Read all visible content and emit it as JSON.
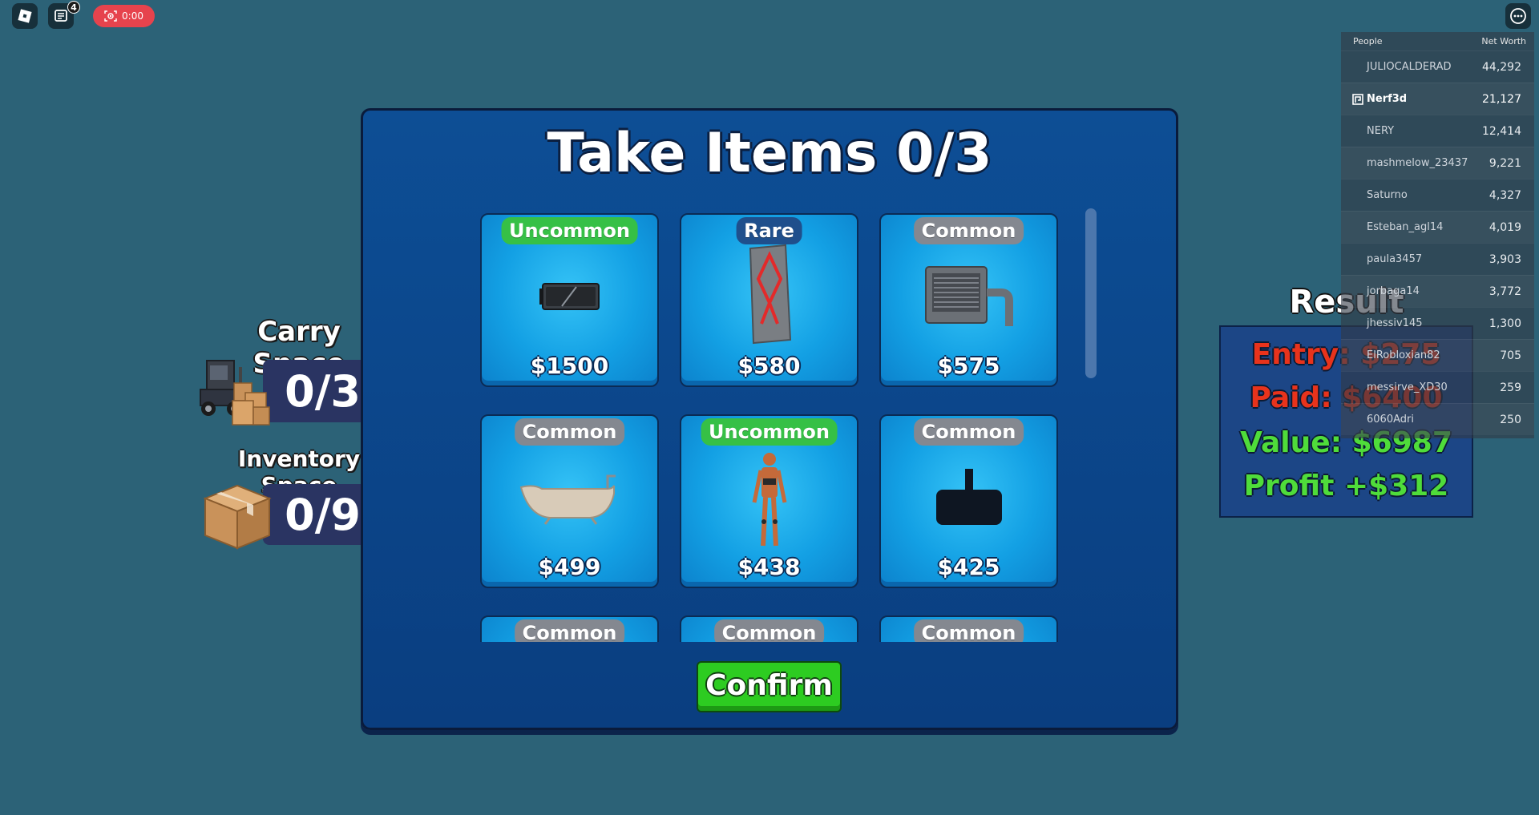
{
  "topbar": {
    "chat_badge": "4",
    "record_time": "0:00"
  },
  "carry": {
    "title": "Carry Space",
    "value": "0/3"
  },
  "inventory": {
    "title": "Inventory Space",
    "value": "0/9"
  },
  "panel": {
    "title": "Take Items 0/3",
    "confirm_label": "Confirm",
    "items": [
      {
        "rarity": "Uncommon",
        "price": "$1500",
        "icon": "graphics-card-icon"
      },
      {
        "rarity": "Rare",
        "price": "$580",
        "icon": "rune-stone-icon"
      },
      {
        "rarity": "Common",
        "price": "$575",
        "icon": "ac-unit-icon"
      },
      {
        "rarity": "Common",
        "price": "$499",
        "icon": "bathtub-icon"
      },
      {
        "rarity": "Uncommon",
        "price": "$438",
        "icon": "mannequin-icon"
      },
      {
        "rarity": "Common",
        "price": "$425",
        "icon": "vr-headset-icon"
      },
      {
        "rarity": "Common",
        "price": "",
        "icon": ""
      },
      {
        "rarity": "Common",
        "price": "",
        "icon": ""
      },
      {
        "rarity": "Common",
        "price": "",
        "icon": ""
      }
    ]
  },
  "result": {
    "title": "Result",
    "entry": "Entry: $275",
    "paid": "Paid: $6400",
    "value": "Value: $6987",
    "profit": "Profit +$312"
  },
  "leaderboard": {
    "col_people": "People",
    "col_networth": "Net Worth",
    "rows": [
      {
        "name": "JULIOCALDERAD",
        "value": "44,292"
      },
      {
        "name": "Nerf3d",
        "value": "21,127"
      },
      {
        "name": "NERY",
        "value": "12,414"
      },
      {
        "name": "mashmelow_23437",
        "value": "9,221"
      },
      {
        "name": "Saturno",
        "value": "4,327"
      },
      {
        "name": "Esteban_agl14",
        "value": "4,019"
      },
      {
        "name": "paula3457",
        "value": "3,903"
      },
      {
        "name": "jorbaga14",
        "value": "3,772"
      },
      {
        "name": "jhessiv145",
        "value": "1,300"
      },
      {
        "name": "ElRobloxian82",
        "value": "705"
      },
      {
        "name": "messirve_XD30",
        "value": "259"
      },
      {
        "name": "6060Adri",
        "value": "250"
      }
    ]
  },
  "colors": {
    "background": "#2c6277",
    "panel": "#0d4e95",
    "uncommon": "#36c046",
    "rare": "#1f4f8c",
    "common": "#848890",
    "confirm": "#2dcc21",
    "entry_red": "#e8331c",
    "value_green": "#4fdc3a"
  }
}
